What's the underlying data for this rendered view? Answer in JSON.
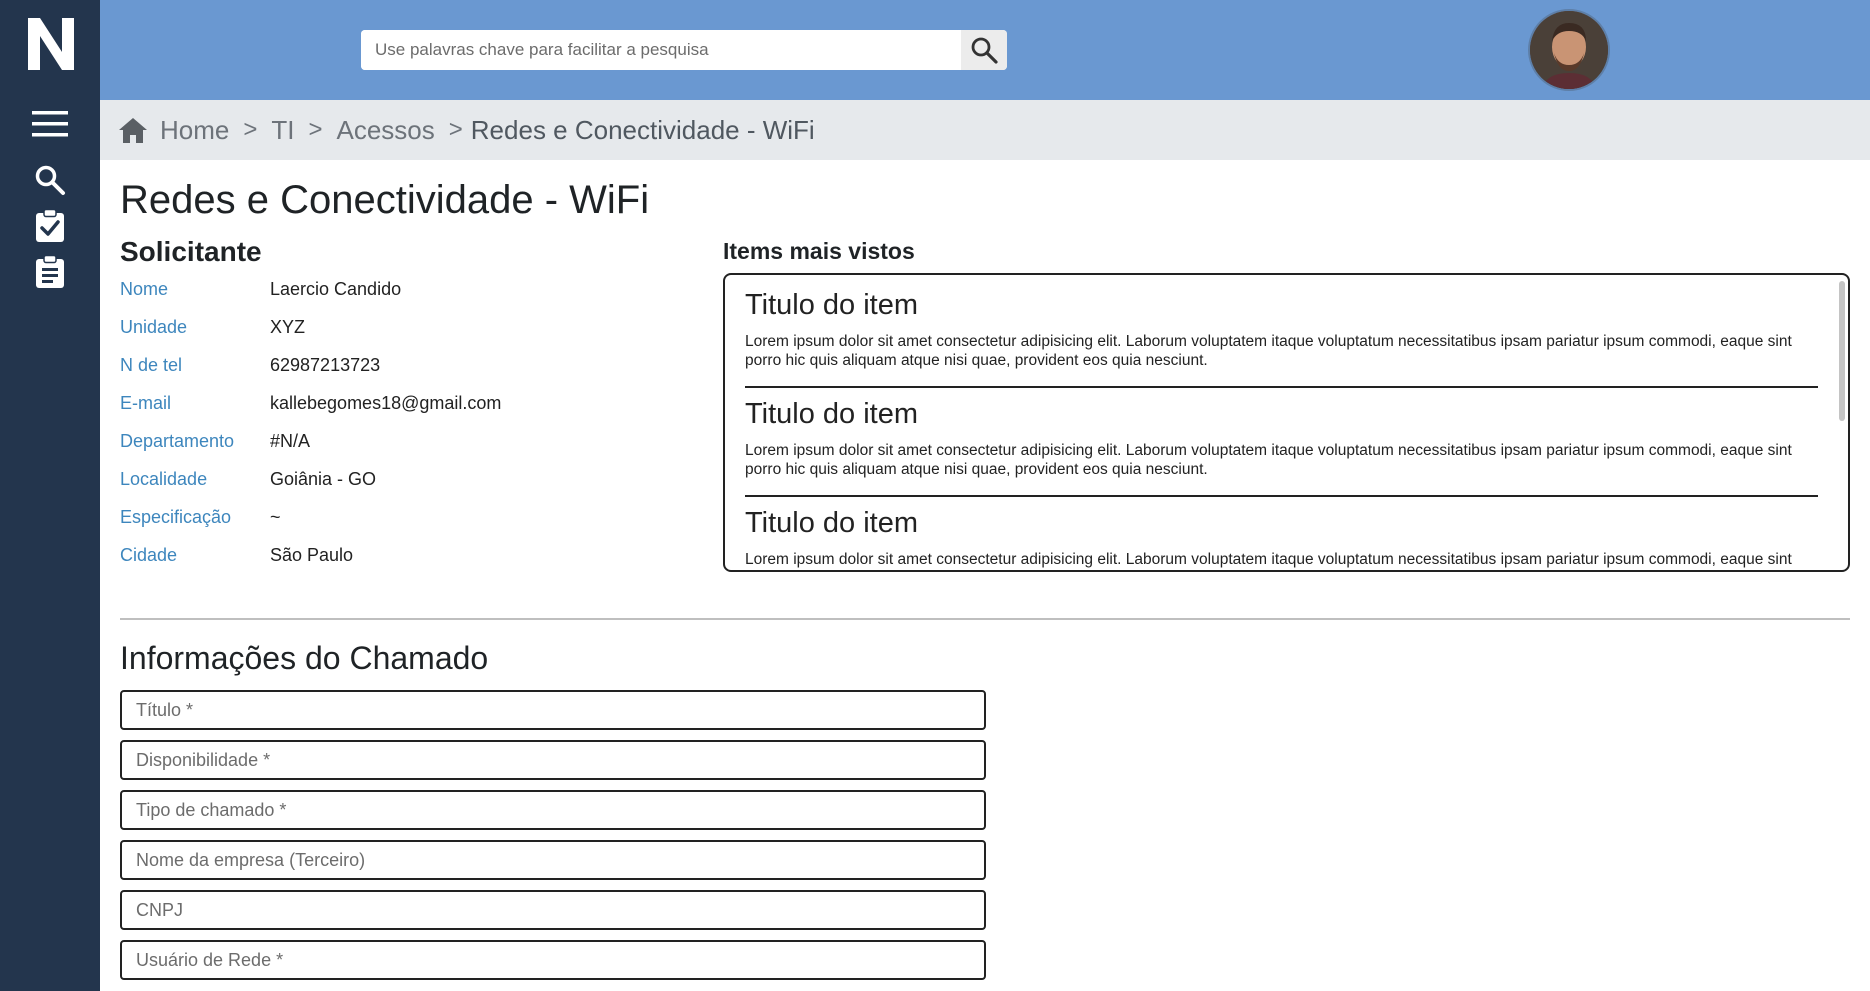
{
  "sidebar": {
    "logo_text": "N",
    "icons": [
      "menu-icon",
      "search-icon",
      "clipboard-check-icon",
      "clipboard-list-icon"
    ]
  },
  "header": {
    "search_placeholder": "Use palavras chave para facilitar a pesquisa"
  },
  "breadcrumb": {
    "items": [
      "Home",
      "TI",
      "Acessos",
      "Redes e Conectividade - WiFi"
    ],
    "separator": ">"
  },
  "page": {
    "title": "Redes e Conectividade - WiFi"
  },
  "requester": {
    "heading": "Solicitante",
    "fields": [
      {
        "label": "Nome",
        "value": "Laercio Candido"
      },
      {
        "label": "Unidade",
        "value": "XYZ"
      },
      {
        "label": "N de tel",
        "value": "62987213723"
      },
      {
        "label": "E-mail",
        "value": "kallebegomes18@gmail.com"
      },
      {
        "label": "Departamento",
        "value": "#N/A"
      },
      {
        "label": "Localidade",
        "value": "Goiânia - GO"
      },
      {
        "label": "Especificação",
        "value": "~"
      },
      {
        "label": "Cidade",
        "value": "São Paulo"
      }
    ]
  },
  "most_viewed": {
    "heading": "Items mais vistos",
    "items": [
      {
        "title": "Titulo do item",
        "text": "Lorem ipsum dolor sit amet consectetur adipisicing elit. Laborum voluptatem itaque voluptatum necessitatibus ipsam pariatur ipsum commodi, eaque sint porro hic quis aliquam atque nisi quae, provident eos quia nesciunt."
      },
      {
        "title": "Titulo do item",
        "text": "Lorem ipsum dolor sit amet consectetur adipisicing elit. Laborum voluptatem itaque voluptatum necessitatibus ipsam pariatur ipsum commodi, eaque sint porro hic quis aliquam atque nisi quae, provident eos quia nesciunt."
      },
      {
        "title": "Titulo do item",
        "text": "Lorem ipsum dolor sit amet consectetur adipisicing elit. Laborum voluptatem itaque voluptatum necessitatibus ipsam pariatur ipsum commodi, eaque sint porro hic quis aliquam atque nisi quae, provident eos quia nesciunt."
      }
    ]
  },
  "ticket_form": {
    "heading": "Informações do Chamado",
    "fields": [
      {
        "placeholder": "Título *"
      },
      {
        "placeholder": "Disponibilidade *"
      },
      {
        "placeholder": "Tipo de chamado *"
      },
      {
        "placeholder": "Nome da empresa (Terceiro)"
      },
      {
        "placeholder": "CNPJ"
      },
      {
        "placeholder": "Usuário de Rede *"
      }
    ]
  },
  "colors": {
    "sidebar": "#23354d",
    "topbar": "#6a98d1",
    "breadcrumb_bg": "#e6e9ec",
    "label_blue": "#3d86bd"
  }
}
